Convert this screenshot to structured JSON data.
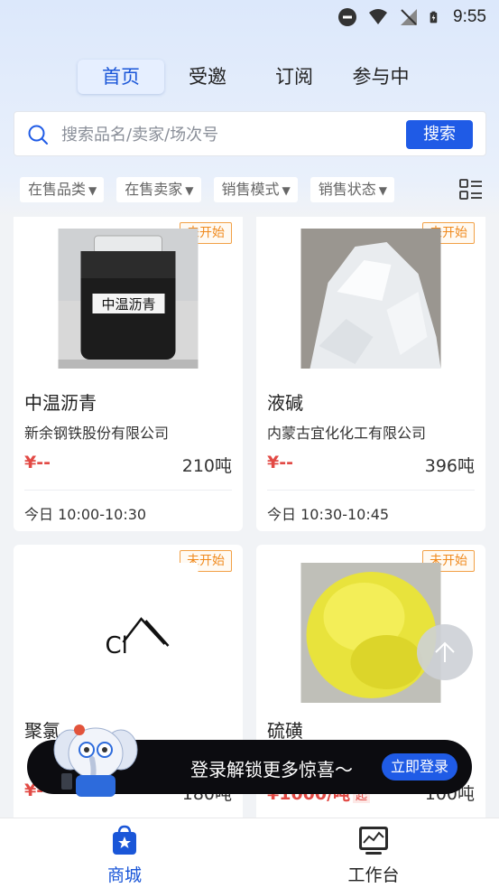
{
  "status_bar": {
    "time": "9:55"
  },
  "tabs": [
    {
      "label": "首页",
      "active": true
    },
    {
      "label": "受邀",
      "active": false
    },
    {
      "label": "订阅",
      "active": false
    },
    {
      "label": "参与中",
      "active": false
    }
  ],
  "search": {
    "placeholder": "搜索品名/卖家/场次号",
    "button_label": "搜索"
  },
  "filters": [
    {
      "label": "在售品类"
    },
    {
      "label": "在售卖家"
    },
    {
      "label": "销售模式"
    },
    {
      "label": "销售状态"
    }
  ],
  "products": [
    {
      "badge": "未开始",
      "name": "中温沥青",
      "image_label": "中温沥青",
      "seller": "新余钢铁股份有限公司",
      "price": "¥--",
      "quantity": "210吨",
      "time": "今日 10:00-10:30"
    },
    {
      "badge": "未开始",
      "name": "液碱",
      "seller": "内蒙古宜化化工有限公司",
      "price": "¥--",
      "quantity": "396吨",
      "time": "今日 10:30-10:45"
    },
    {
      "badge": "未开始",
      "name": "聚氯",
      "image_label": "Cl",
      "seller": "",
      "price": "¥--",
      "quantity": "180吨",
      "time": ""
    },
    {
      "badge": "未开始",
      "name": "硫磺",
      "seller": "",
      "price": "¥1000/吨",
      "price_tag": "起",
      "quantity": "100吨",
      "time": ""
    }
  ],
  "login_banner": {
    "text": "登录解锁更多惊喜～",
    "button_label": "立即登录"
  },
  "bottom_nav": [
    {
      "label": "商城",
      "icon": "shop-bag-icon",
      "active": true
    },
    {
      "label": "工作台",
      "icon": "workbench-monitor-icon",
      "active": false
    }
  ],
  "colors": {
    "accent": "#1f5be6",
    "badge": "#f08a1d",
    "price": "#e24a45"
  }
}
